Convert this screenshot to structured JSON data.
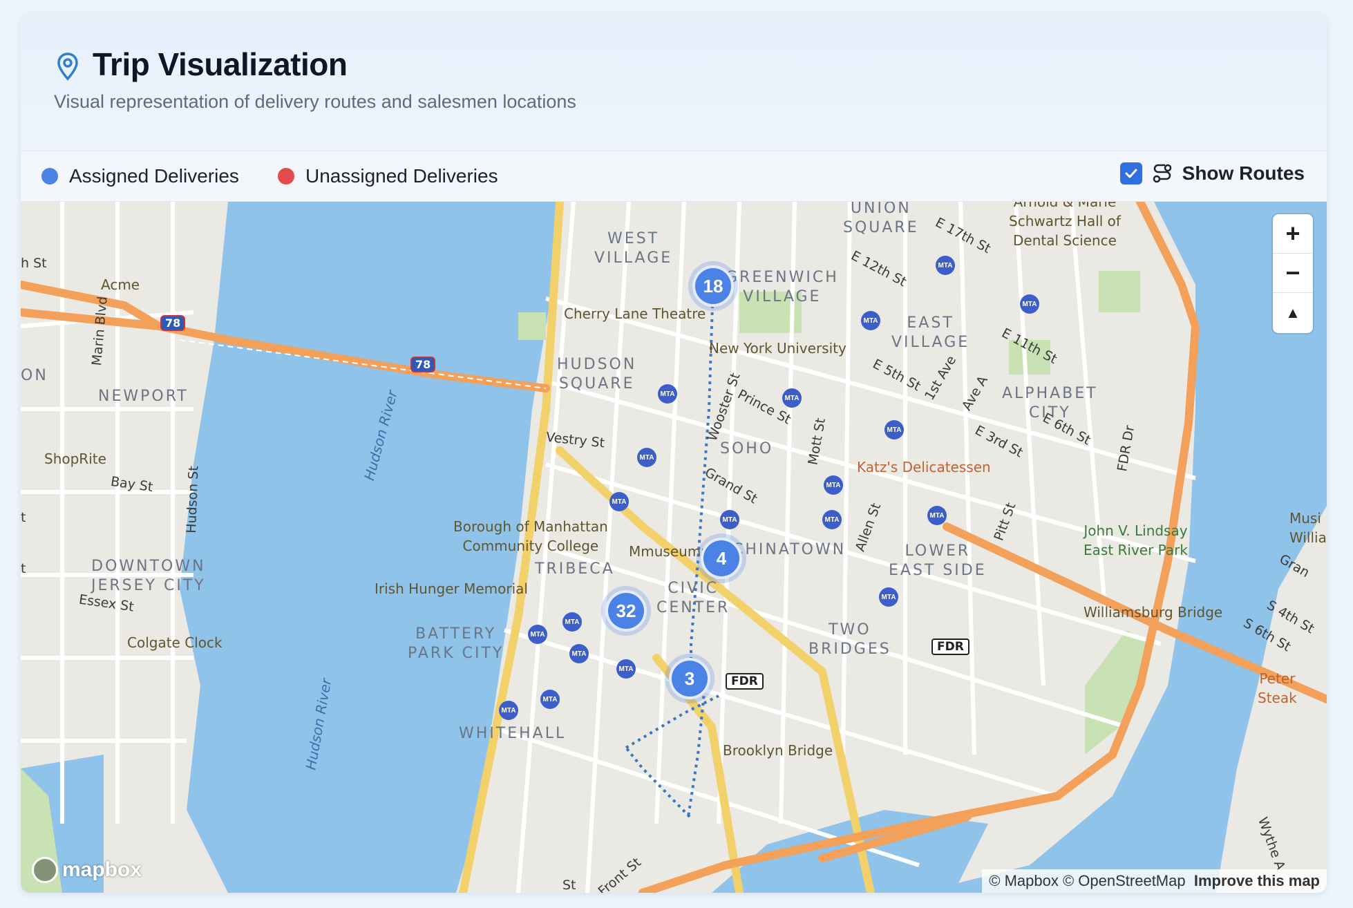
{
  "header": {
    "title": "Trip Visualization",
    "subtitle": "Visual representation of delivery routes and salesmen locations"
  },
  "legend": {
    "assigned_label": "Assigned Deliveries",
    "assigned_color": "#4a82e6",
    "unassigned_label": "Unassigned Deliveries",
    "unassigned_color": "#e24b4b",
    "show_routes_label": "Show Routes",
    "show_routes_checked": true
  },
  "map": {
    "clusters": [
      {
        "count": "18"
      },
      {
        "count": "4"
      },
      {
        "count": "32"
      },
      {
        "count": "3"
      }
    ],
    "area_labels": {
      "union_square": "UNION\nSQUARE",
      "west_village": "WEST\nVILLAGE",
      "greenwich_village": "GREENWICH\nVILLAGE",
      "east_village": "EAST\nVILLAGE",
      "hudson_square": "HUDSON\nSQUARE",
      "alphabet_city": "ALPHABET\nCITY",
      "soho": "SOHO",
      "newport": "NEWPORT",
      "chinatown": "CHINATOWN",
      "lower_east_side": "LOWER\nEAST SIDE",
      "tribeca": "TRIBECA",
      "civic_center": "CIVIC\nCENTER",
      "downtown_jersey_city": "DOWNTOWN\nJERSEY CITY",
      "battery_park_city": "BATTERY\nPARK CITY",
      "two_bridges": "TWO\nBRIDGES",
      "whitehall": "WHITEHALL"
    },
    "street_labels": {
      "e17": "E 17th St",
      "e12": "E 12th St",
      "e11": "E 11th St",
      "e5": "E 5th St",
      "e6": "E 6th St",
      "e3": "E 3rd St",
      "first_ave": "1st Ave",
      "ave_a": "Ave A",
      "wooster": "Wooster St",
      "prince": "Prince St",
      "mott": "Mott St",
      "grand": "Grand St",
      "vestry": "Vestry St",
      "allen": "Allen St",
      "pitt": "Pitt St",
      "fdr_dr": "FDR Dr",
      "marin": "Marin Blvd",
      "bay": "Bay St",
      "hudson": "Hudson St",
      "essex": "Essex St",
      "front": "Front St",
      "s4": "S 4th St",
      "s6": "S 6th St",
      "wythe": "Wythe A",
      "h_st": "h St",
      "on": "ON",
      "st": "St",
      "t": "t",
      "gran": "Gran",
      "musi": "Musi\nWillia"
    },
    "poi_labels": {
      "schwartz": "Arnold & Marie\nSchwartz Hall of\nDental Science",
      "cherry_lane": "Cherry Lane Theatre",
      "nyu": "New York University",
      "katz": "Katz's Delicatessen",
      "bmcc": "Borough of Manhattan\nCommunity College",
      "mmuseumm": "Mmuseumm",
      "irish": "Irish Hunger Memorial",
      "lindsay": "John V. Lindsay\nEast River Park",
      "williamsburg": "Williamsburg Bridge",
      "brooklyn": "Brooklyn Bridge",
      "colgate": "Colgate Clock",
      "acme": "Acme",
      "shoprite": "ShopRite",
      "peter": "Peter\nSteak",
      "hudson_river_1": "Hudson River",
      "hudson_river_2": "Hudson River",
      "fdr1": "FDR",
      "fdr2": "FDR",
      "i78a": "78",
      "i78b": "78"
    },
    "zoom_in": "+",
    "zoom_out": "−",
    "compass": "▲",
    "attribution": "© Mapbox © OpenStreetMap",
    "improve": "Improve this map",
    "logo": "mapbox"
  }
}
